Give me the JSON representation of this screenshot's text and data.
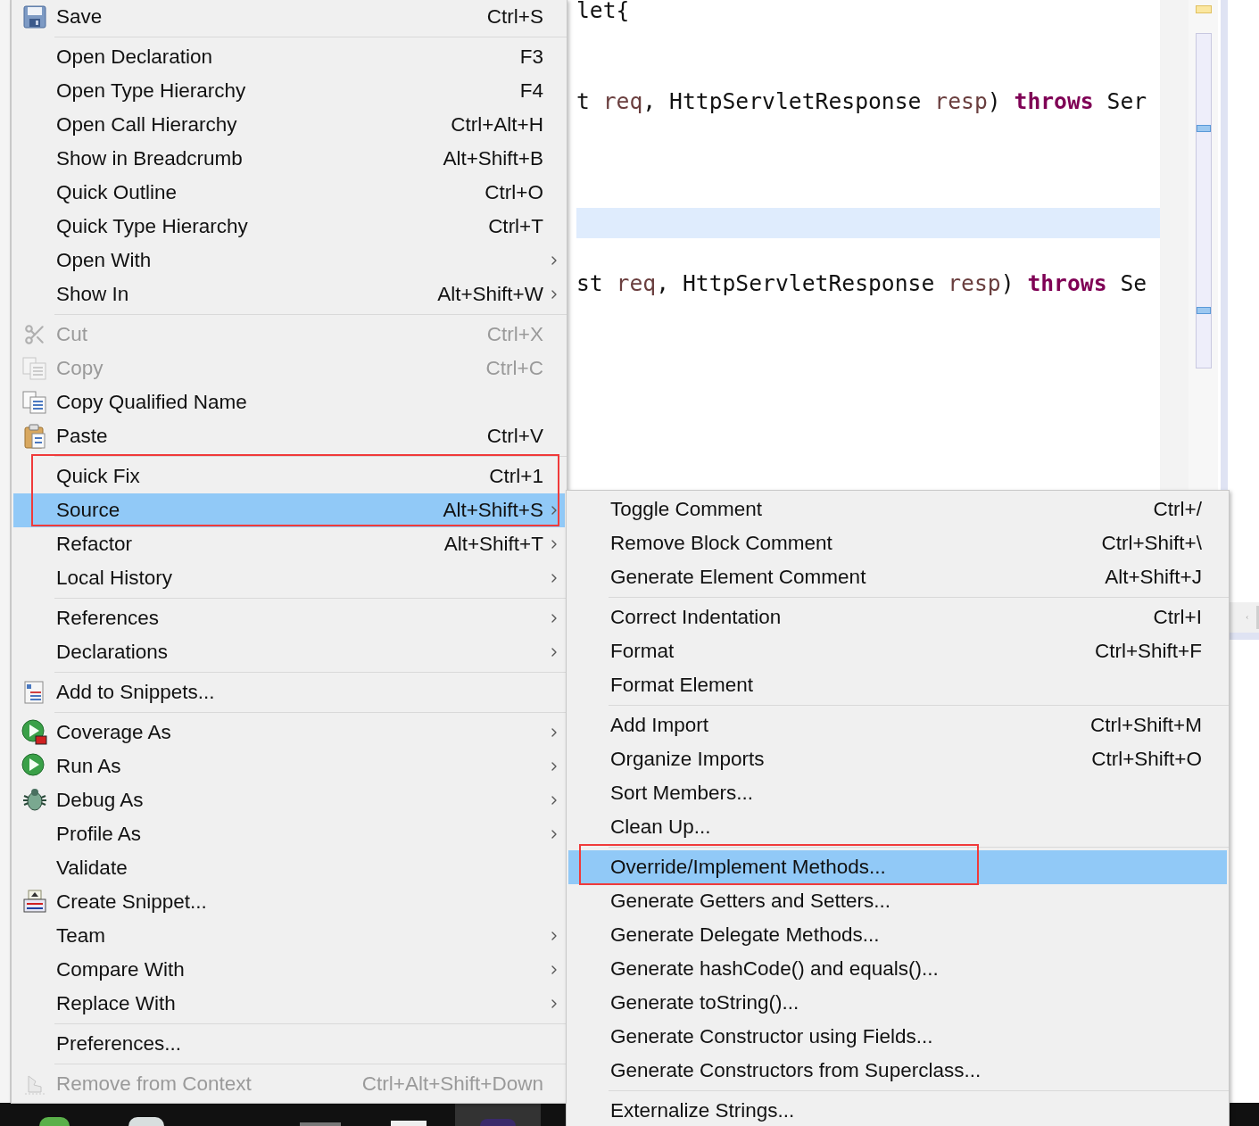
{
  "editor": {
    "lines": [
      {
        "current": false,
        "tokens": [
          {
            "text": "let{",
            "kind": "plain"
          }
        ]
      },
      {
        "current": false
      },
      {
        "current": false
      },
      {
        "current": false,
        "tokens": [
          {
            "text": "t ",
            "kind": "plain"
          },
          {
            "text": "req",
            "kind": "param"
          },
          {
            "text": ", HttpServletResponse ",
            "kind": "plain"
          },
          {
            "text": "resp",
            "kind": "param"
          },
          {
            "text": ") ",
            "kind": "plain"
          },
          {
            "text": "throws",
            "kind": "keyword"
          },
          {
            "text": " Ser",
            "kind": "plain"
          }
        ]
      },
      {
        "current": false
      },
      {
        "current": false
      },
      {
        "current": false
      },
      {
        "current": true
      },
      {
        "current": false
      },
      {
        "current": false,
        "tokens": [
          {
            "text": "st ",
            "kind": "plain"
          },
          {
            "text": "req",
            "kind": "param"
          },
          {
            "text": ", HttpServletResponse ",
            "kind": "plain"
          },
          {
            "text": "resp",
            "kind": "param"
          },
          {
            "text": ") ",
            "kind": "plain"
          },
          {
            "text": "throws",
            "kind": "keyword"
          },
          {
            "text": " Se",
            "kind": "plain"
          }
        ]
      }
    ]
  },
  "main_menu": {
    "groups": [
      {
        "items": [
          {
            "label": "Save",
            "shortcut": "Ctrl+S",
            "submenu": false,
            "disabled": false,
            "selected": false
          }
        ]
      },
      {
        "items": [
          {
            "label": "Open Declaration",
            "shortcut": "F3",
            "submenu": false,
            "disabled": false,
            "selected": false
          },
          {
            "label": "Open Type Hierarchy",
            "shortcut": "F4",
            "submenu": false,
            "disabled": false,
            "selected": false
          },
          {
            "label": "Open Call Hierarchy",
            "shortcut": "Ctrl+Alt+H",
            "submenu": false,
            "disabled": false,
            "selected": false
          },
          {
            "label": "Show in Breadcrumb",
            "shortcut": "Alt+Shift+B",
            "submenu": false,
            "disabled": false,
            "selected": false
          },
          {
            "label": "Quick Outline",
            "shortcut": "Ctrl+O",
            "submenu": false,
            "disabled": false,
            "selected": false
          },
          {
            "label": "Quick Type Hierarchy",
            "shortcut": "Ctrl+T",
            "submenu": false,
            "disabled": false,
            "selected": false
          },
          {
            "label": "Open With",
            "submenu": true,
            "disabled": false,
            "selected": false
          },
          {
            "label": "Show In",
            "shortcut": "Alt+Shift+W",
            "submenu": true,
            "disabled": false,
            "selected": false
          }
        ]
      },
      {
        "items": [
          {
            "label": "Cut",
            "shortcut": "Ctrl+X",
            "submenu": false,
            "disabled": true,
            "selected": false
          },
          {
            "label": "Copy",
            "shortcut": "Ctrl+C",
            "submenu": false,
            "disabled": true,
            "selected": false
          },
          {
            "label": "Copy Qualified Name",
            "submenu": false,
            "disabled": false,
            "selected": false
          },
          {
            "label": "Paste",
            "shortcut": "Ctrl+V",
            "submenu": false,
            "disabled": false,
            "selected": false
          }
        ]
      },
      {
        "items": [
          {
            "label": "Quick Fix",
            "shortcut": "Ctrl+1",
            "submenu": false,
            "disabled": false,
            "selected": false
          },
          {
            "label": "Source",
            "shortcut": "Alt+Shift+S",
            "submenu": true,
            "disabled": false,
            "selected": true
          },
          {
            "label": "Refactor",
            "shortcut": "Alt+Shift+T",
            "submenu": true,
            "disabled": false,
            "selected": false
          },
          {
            "label": "Local History",
            "submenu": true,
            "disabled": false,
            "selected": false
          }
        ]
      },
      {
        "items": [
          {
            "label": "References",
            "submenu": true,
            "disabled": false,
            "selected": false
          },
          {
            "label": "Declarations",
            "submenu": true,
            "disabled": false,
            "selected": false
          }
        ]
      },
      {
        "items": [
          {
            "label": "Add to Snippets...",
            "submenu": false,
            "disabled": false,
            "selected": false
          }
        ]
      },
      {
        "items": [
          {
            "label": "Coverage As",
            "submenu": true,
            "disabled": false,
            "selected": false
          },
          {
            "label": "Run As",
            "submenu": true,
            "disabled": false,
            "selected": false
          },
          {
            "label": "Debug As",
            "submenu": true,
            "disabled": false,
            "selected": false
          },
          {
            "label": "Profile As",
            "submenu": true,
            "disabled": false,
            "selected": false
          },
          {
            "label": "Validate",
            "submenu": false,
            "disabled": false,
            "selected": false
          },
          {
            "label": "Create Snippet...",
            "submenu": false,
            "disabled": false,
            "selected": false
          },
          {
            "label": "Team",
            "submenu": true,
            "disabled": false,
            "selected": false
          },
          {
            "label": "Compare With",
            "submenu": true,
            "disabled": false,
            "selected": false
          },
          {
            "label": "Replace With",
            "submenu": true,
            "disabled": false,
            "selected": false
          }
        ]
      },
      {
        "items": [
          {
            "label": "Preferences...",
            "submenu": false,
            "disabled": false,
            "selected": false
          }
        ]
      },
      {
        "items": [
          {
            "label": "Remove from Context",
            "shortcut": "Ctrl+Alt+Shift+Down",
            "submenu": false,
            "disabled": true,
            "selected": false
          }
        ]
      }
    ]
  },
  "source_submenu": {
    "groups": [
      {
        "items": [
          {
            "label": "Toggle Comment",
            "shortcut": "Ctrl+/",
            "disabled": false,
            "selected": false
          },
          {
            "label": "Remove Block Comment",
            "shortcut": "Ctrl+Shift+\\",
            "disabled": false,
            "selected": false
          },
          {
            "label": "Generate Element Comment",
            "shortcut": "Alt+Shift+J",
            "disabled": false,
            "selected": false
          }
        ]
      },
      {
        "items": [
          {
            "label": "Correct Indentation",
            "shortcut": "Ctrl+I",
            "disabled": false,
            "selected": false
          },
          {
            "label": "Format",
            "shortcut": "Ctrl+Shift+F",
            "disabled": false,
            "selected": false
          },
          {
            "label": "Format Element",
            "disabled": false,
            "selected": false
          }
        ]
      },
      {
        "items": [
          {
            "label": "Add Import",
            "shortcut": "Ctrl+Shift+M",
            "disabled": false,
            "selected": false
          },
          {
            "label": "Organize Imports",
            "shortcut": "Ctrl+Shift+O",
            "disabled": false,
            "selected": false
          },
          {
            "label": "Sort Members...",
            "disabled": false,
            "selected": false
          },
          {
            "label": "Clean Up...",
            "disabled": false,
            "selected": false
          }
        ]
      },
      {
        "items": [
          {
            "label": "Override/Implement Methods...",
            "disabled": false,
            "selected": true
          },
          {
            "label": "Generate Getters and Setters...",
            "disabled": false,
            "selected": false
          },
          {
            "label": "Generate Delegate Methods...",
            "disabled": false,
            "selected": false
          },
          {
            "label": "Generate hashCode() and equals()...",
            "disabled": false,
            "selected": false
          },
          {
            "label": "Generate toString()...",
            "disabled": false,
            "selected": false
          },
          {
            "label": "Generate Constructor using Fields...",
            "disabled": false,
            "selected": false
          },
          {
            "label": "Generate Constructors from Superclass...",
            "disabled": false,
            "selected": false
          }
        ]
      },
      {
        "items": [
          {
            "label": "Externalize Strings...",
            "disabled": false,
            "selected": false
          }
        ]
      }
    ]
  }
}
